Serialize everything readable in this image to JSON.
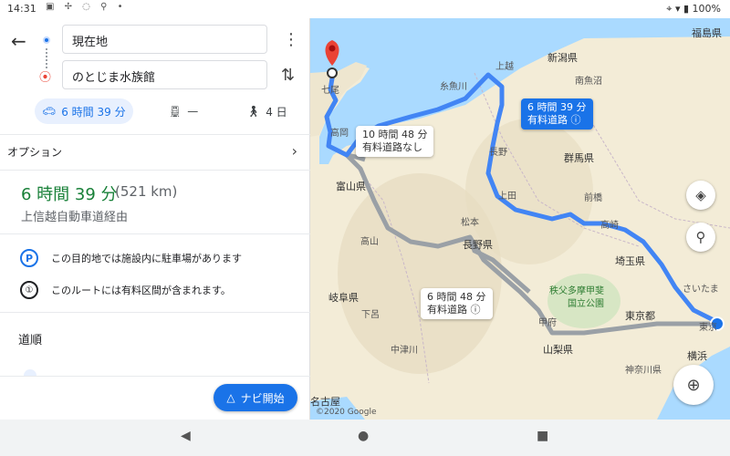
{
  "status_bar": {
    "time": "14:31",
    "battery": "100%"
  },
  "directions": {
    "origin": "現在地",
    "destination": "のとじま水族館",
    "modes": [
      {
        "name": "car",
        "label": "6 時間 39 分",
        "selected": true
      },
      {
        "name": "transit",
        "label": "—",
        "selected": false
      },
      {
        "name": "walk",
        "label": "4 日",
        "selected": false
      }
    ],
    "options_label": "オプション",
    "summary": {
      "duration": "6 時間 39 分",
      "distance": "(521 km)",
      "via": "上信越自動車道経由"
    },
    "notes": [
      {
        "badge": "P",
        "text": "この目的地では施設内に駐車場があります"
      },
      {
        "badge": "①",
        "text": "このルートには有料区間が含まれます。"
      }
    ],
    "steps_title": "道順",
    "nav_button": "ナビ開始"
  },
  "map": {
    "callouts": [
      {
        "line1": "6 時間 39 分",
        "line2": "有料道路 ⓘ",
        "selected": true
      },
      {
        "line1": "10 時間 48 分",
        "line2": "有料道路なし",
        "selected": false
      },
      {
        "line1": "6 時間 48 分",
        "line2": "有料道路 ⓘ",
        "selected": false
      }
    ],
    "labels": [
      "七尾",
      "糸魚川",
      "上越",
      "新潟県",
      "南魚沼",
      "福島県",
      "高岡",
      "長野",
      "群馬県",
      "富山県",
      "上田",
      "前橋",
      "高崎",
      "松本",
      "長野県",
      "高山",
      "埼玉県",
      "岐阜県",
      "秩父多摩甲斐",
      "国立公園",
      "さいたま",
      "下呂",
      "甲府",
      "東京都",
      "山梨県",
      "中津川",
      "横浜",
      "神奈川県",
      "名古屋",
      "東京"
    ],
    "copyright": "©2020 Google",
    "colors": {
      "selected_route": "#4285f4",
      "alt_route": "#9aa0a6",
      "water": "#aadaff",
      "land": "#f3ecd7"
    }
  }
}
